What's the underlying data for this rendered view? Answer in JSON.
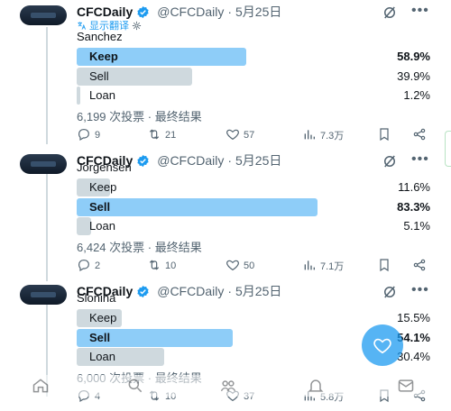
{
  "tweets": [
    {
      "author_name": "CFCDaily",
      "handle": "@CFCDaily",
      "date": "5月25日",
      "translate_label": "显示翻译",
      "subject": "Sanchez",
      "options": [
        {
          "label": "Keep",
          "percent": "58.9%",
          "share": 58.9,
          "winner": true
        },
        {
          "label": "Sell",
          "percent": "39.9%",
          "share": 39.9,
          "winner": false
        },
        {
          "label": "Loan",
          "percent": "1.2%",
          "share": 1.2,
          "winner": false
        }
      ],
      "votes_summary": "6,199 次投票 · 最终结果",
      "replies": "9",
      "retweets": "21",
      "likes": "57",
      "views": "7.3万"
    },
    {
      "author_name": "CFCDaily",
      "handle": "@CFCDaily",
      "date": "5月25日",
      "subject": "Jorgensen",
      "options": [
        {
          "label": "Keep",
          "percent": "11.6%",
          "share": 11.6,
          "winner": false
        },
        {
          "label": "Sell",
          "percent": "83.3%",
          "share": 83.3,
          "winner": true
        },
        {
          "label": "Loan",
          "percent": "5.1%",
          "share": 5.1,
          "winner": false
        }
      ],
      "votes_summary": "6,424 次投票 · 最终结果",
      "replies": "2",
      "retweets": "10",
      "likes": "50",
      "views": "7.1万"
    },
    {
      "author_name": "CFCDaily",
      "handle": "@CFCDaily",
      "date": "5月25日",
      "subject": "Slonina",
      "options": [
        {
          "label": "Keep",
          "percent": "15.5%",
          "share": 15.5,
          "winner": false
        },
        {
          "label": "Sell",
          "percent": "54.1%",
          "share": 54.1,
          "winner": true
        },
        {
          "label": "Loan",
          "percent": "30.4%",
          "share": 30.4,
          "winner": false
        }
      ],
      "votes_summary": "6,000 次投票 · 最终结果",
      "replies": "4",
      "retweets": "10",
      "likes": "37",
      "views": "5.8万"
    }
  ],
  "colors": {
    "accent": "#1d9bf0",
    "winner_bar": "#8ecdf8",
    "loser_bar": "#cfd9de",
    "muted": "#536471"
  }
}
